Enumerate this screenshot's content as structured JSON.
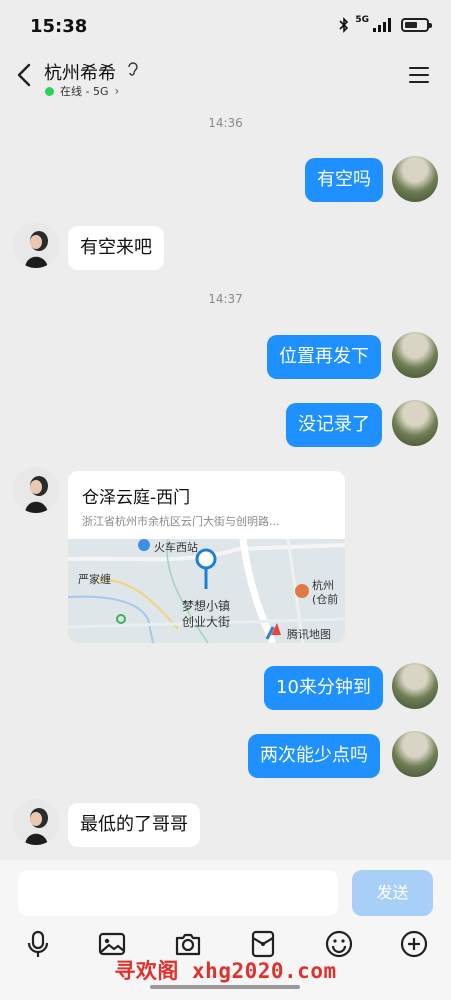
{
  "status_bar": {
    "time": "15:38",
    "network": "5G"
  },
  "header": {
    "title": "杭州希希",
    "online_status": "在线 - 5G"
  },
  "messages": {
    "t1": "14:36",
    "m1": "有空吗",
    "m2": "有空来吧",
    "t2": "14:37",
    "m3": "位置再发下",
    "m4": "没记录了",
    "m7": "10来分钟到",
    "m8": "两次能少点吗",
    "m9": "最低的了哥哥"
  },
  "location": {
    "name": "仓泽云庭-西门",
    "address": "浙江省杭州市余杭区云门大街与创明路...",
    "map_labels": {
      "station": "火车西站",
      "village": "严家缠",
      "town_1": "梦想小镇",
      "town_2": "创业大街",
      "place_1": "杭州",
      "place_2": "(仓前",
      "provider": "腾讯地图"
    }
  },
  "input": {
    "send_label": "发送"
  },
  "watermark": "寻欢阁 xhg2020.com",
  "colors": {
    "outgoing": "#1e90ff",
    "send_disabled": "#a7cff7",
    "online": "#2ed158",
    "watermark": "#e2312d"
  }
}
